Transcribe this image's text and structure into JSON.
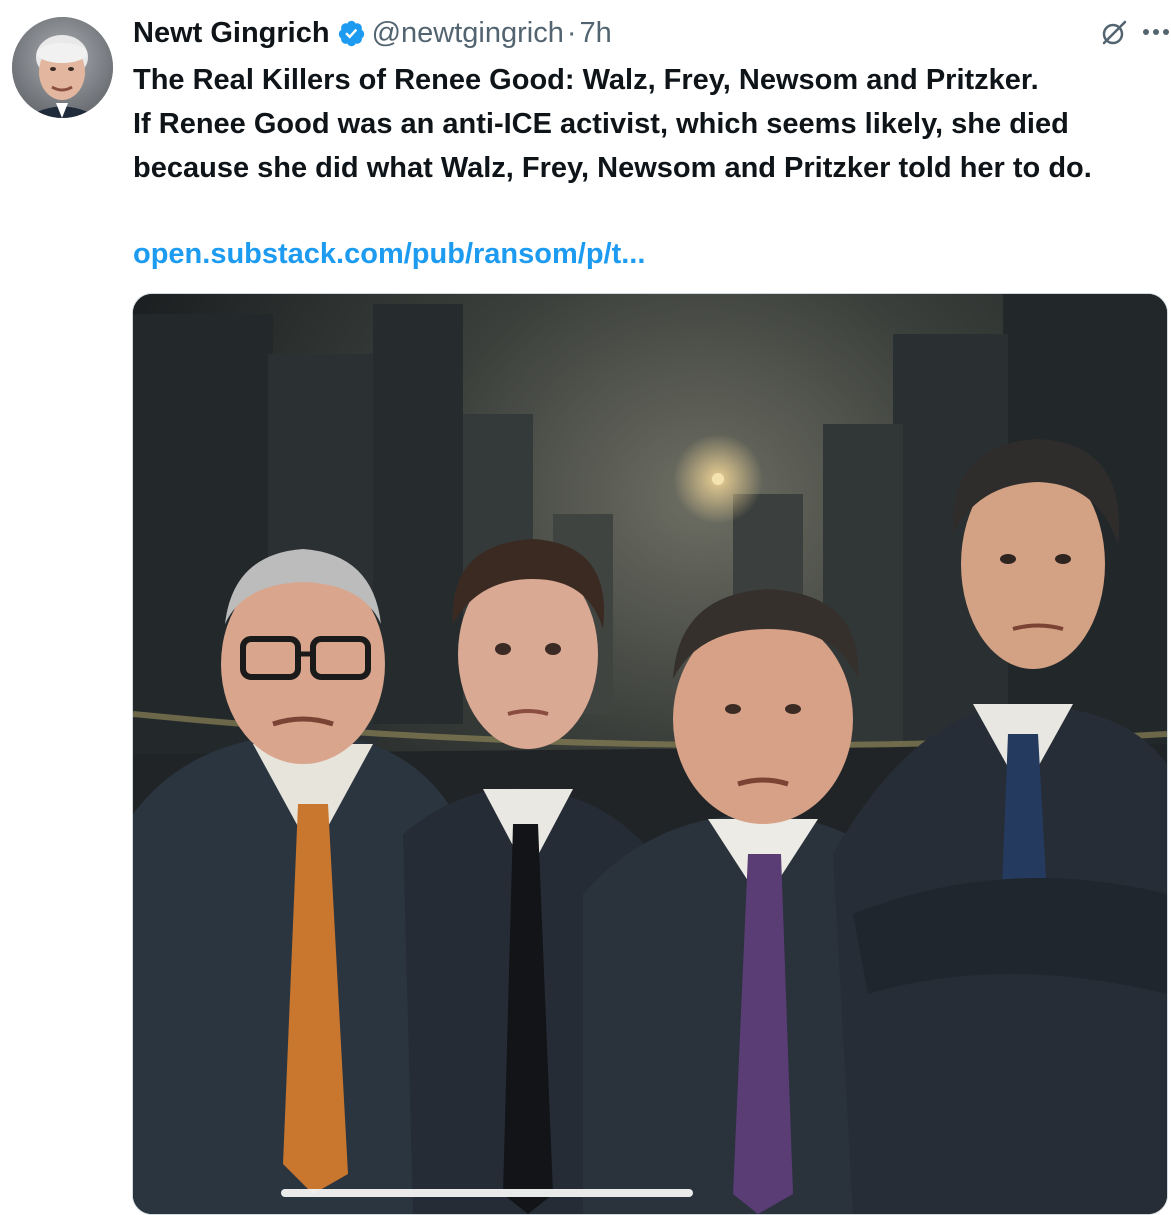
{
  "tweet": {
    "author_name": "Newt Gingrich",
    "handle": "@newtgingrich",
    "separator": "·",
    "time": "7h",
    "text_line1": "The Real Killers of Renee Good: Walz, Frey, Newsom and Pritzker.",
    "text_line2": "If Renee Good was an anti-ICE activist, which seems likely, she died because she did what Walz, Frey, Newsom and Pritzker told her to do.",
    "link": "open.substack.com/pub/ransom/p/t..."
  },
  "icons": {
    "verified": "verified-badge-icon",
    "grok": "grok-icon",
    "more": "more-icon"
  },
  "colors": {
    "text": "#0f1419",
    "secondary": "#536471",
    "link": "#1d9bf0",
    "verified": "#1d9bf0"
  }
}
